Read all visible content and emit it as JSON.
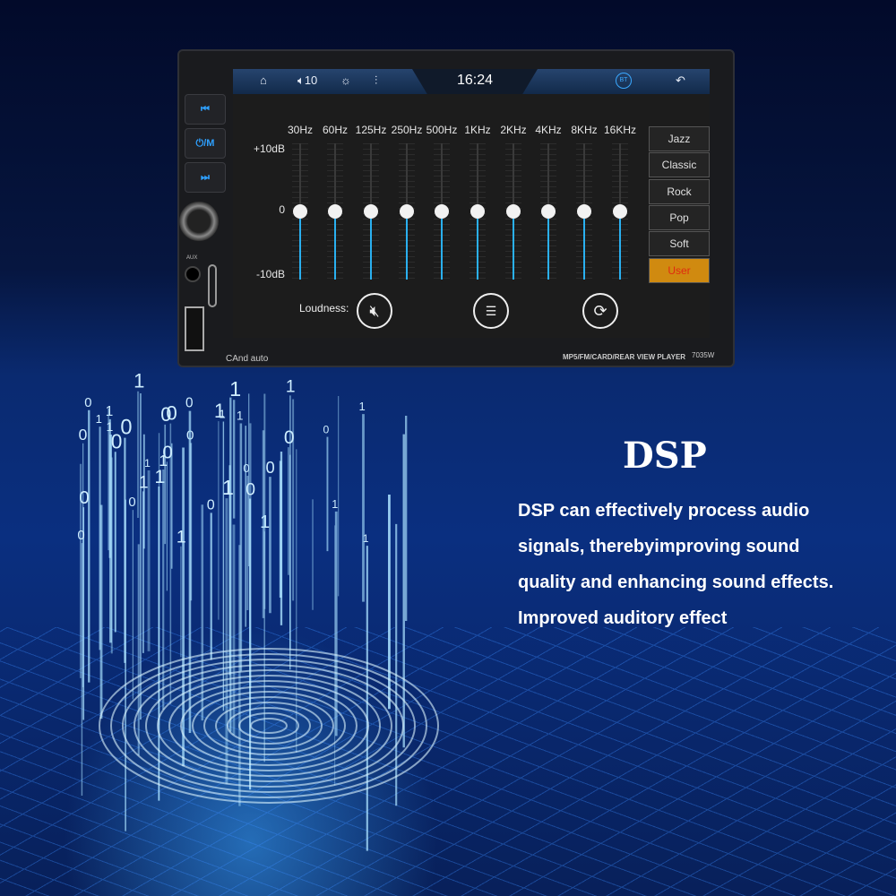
{
  "topbar": {
    "icons": [
      "home-icon",
      "volume-icon",
      "brightness-icon",
      "equalizer-icon",
      "bluetooth-icon",
      "back-icon"
    ],
    "volume": "10",
    "time": "16:24",
    "bt_label": "BT"
  },
  "eq": {
    "bands": [
      "30Hz",
      "60Hz",
      "125Hz",
      "250Hz",
      "500Hz",
      "1KHz",
      "2KHz",
      "4KHz",
      "8KHz",
      "16KHz"
    ],
    "levels_db": [
      0,
      0,
      0,
      0,
      0,
      0,
      0,
      0,
      0,
      0
    ],
    "scale": {
      "top": "+10dB",
      "mid": "0",
      "bottom": "-10dB"
    }
  },
  "presets": [
    {
      "label": "Jazz"
    },
    {
      "label": "Classic"
    },
    {
      "label": "Rock"
    },
    {
      "label": "Pop"
    },
    {
      "label": "Soft"
    },
    {
      "label": "User",
      "active": true
    }
  ],
  "loudness_label": "Loudness:",
  "device": {
    "brand": "CAnd auto",
    "model_desc": "MP5/FM/CARD/REAR VIEW PLAYER",
    "model": "7035W",
    "buttons": [
      "prev",
      "power/mode",
      "next"
    ],
    "btn_mode": "⏻/M",
    "aux": "AUX"
  },
  "colors": {
    "accent": "#2ab0f0",
    "active_preset": "#d08a10",
    "active_text": "#e02a10"
  },
  "promo": {
    "title": "DSP",
    "lines": [
      "DSP can effectively process audio",
      "signals, therebyimproving sound",
      "quality and enhancing sound effects.",
      "Improved auditory effect"
    ]
  }
}
